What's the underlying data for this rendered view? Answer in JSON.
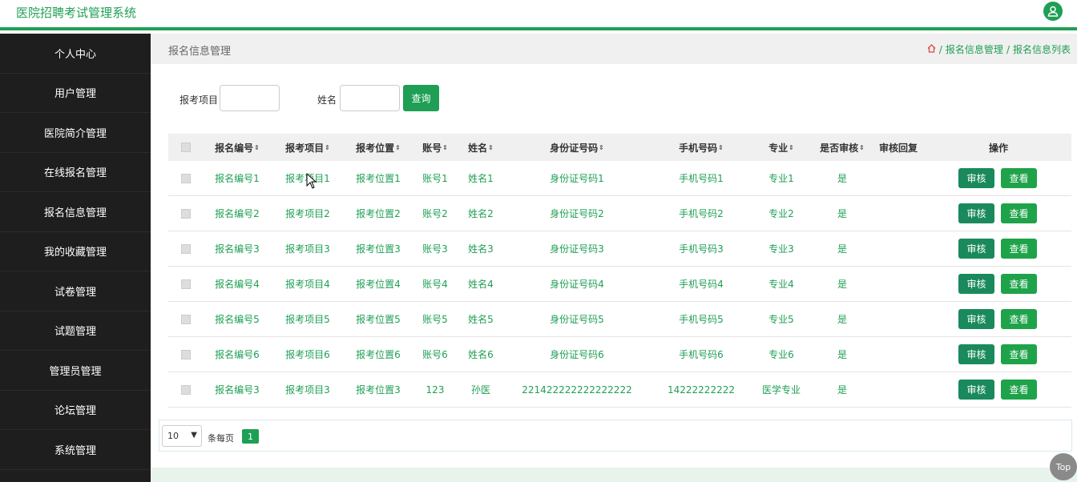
{
  "app": {
    "title": "医院招聘考试管理系统"
  },
  "sidebar": {
    "items": [
      "个人中心",
      "用户管理",
      "医院简介管理",
      "在线报名管理",
      "报名信息管理",
      "我的收藏管理",
      "试卷管理",
      "试题管理",
      "管理员管理",
      "论坛管理",
      "系统管理"
    ]
  },
  "breadcrumb": {
    "title": "报名信息管理",
    "level1": "报名信息管理",
    "level2": "报名信息列表",
    "separator": "/"
  },
  "search": {
    "project_label": "报考项目",
    "name_label": "姓名",
    "query_button": "查询"
  },
  "table": {
    "headers": [
      "报名编号",
      "报考项目",
      "报考位置",
      "账号",
      "姓名",
      "身份证号码",
      "手机号码",
      "专业",
      "是否审核",
      "审核回复",
      "操作"
    ],
    "rows": [
      [
        "报名编号1",
        "报考项目1",
        "报考位置1",
        "账号1",
        "姓名1",
        "身份证号码1",
        "手机号码1",
        "专业1",
        "是",
        ""
      ],
      [
        "报名编号2",
        "报考项目2",
        "报考位置2",
        "账号2",
        "姓名2",
        "身份证号码2",
        "手机号码2",
        "专业2",
        "是",
        ""
      ],
      [
        "报名编号3",
        "报考项目3",
        "报考位置3",
        "账号3",
        "姓名3",
        "身份证号码3",
        "手机号码3",
        "专业3",
        "是",
        ""
      ],
      [
        "报名编号4",
        "报考项目4",
        "报考位置4",
        "账号4",
        "姓名4",
        "身份证号码4",
        "手机号码4",
        "专业4",
        "是",
        ""
      ],
      [
        "报名编号5",
        "报考项目5",
        "报考位置5",
        "账号5",
        "姓名5",
        "身份证号码5",
        "手机号码5",
        "专业5",
        "是",
        ""
      ],
      [
        "报名编号6",
        "报考项目6",
        "报考位置6",
        "账号6",
        "姓名6",
        "身份证号码6",
        "手机号码6",
        "专业6",
        "是",
        ""
      ],
      [
        "报名编号3",
        "报考项目3",
        "报考位置3",
        "123",
        "孙医",
        "221422222222222222",
        "14222222222",
        "医学专业",
        "是",
        ""
      ]
    ],
    "audit_button": "审核",
    "view_button": "查看"
  },
  "pager": {
    "page_size": "10",
    "per_page_label": "条每页",
    "current_page": "1"
  },
  "back_to_top": "Top",
  "colors": {
    "accent": "#1f9f55",
    "sidebar": "#1e1e1e"
  }
}
